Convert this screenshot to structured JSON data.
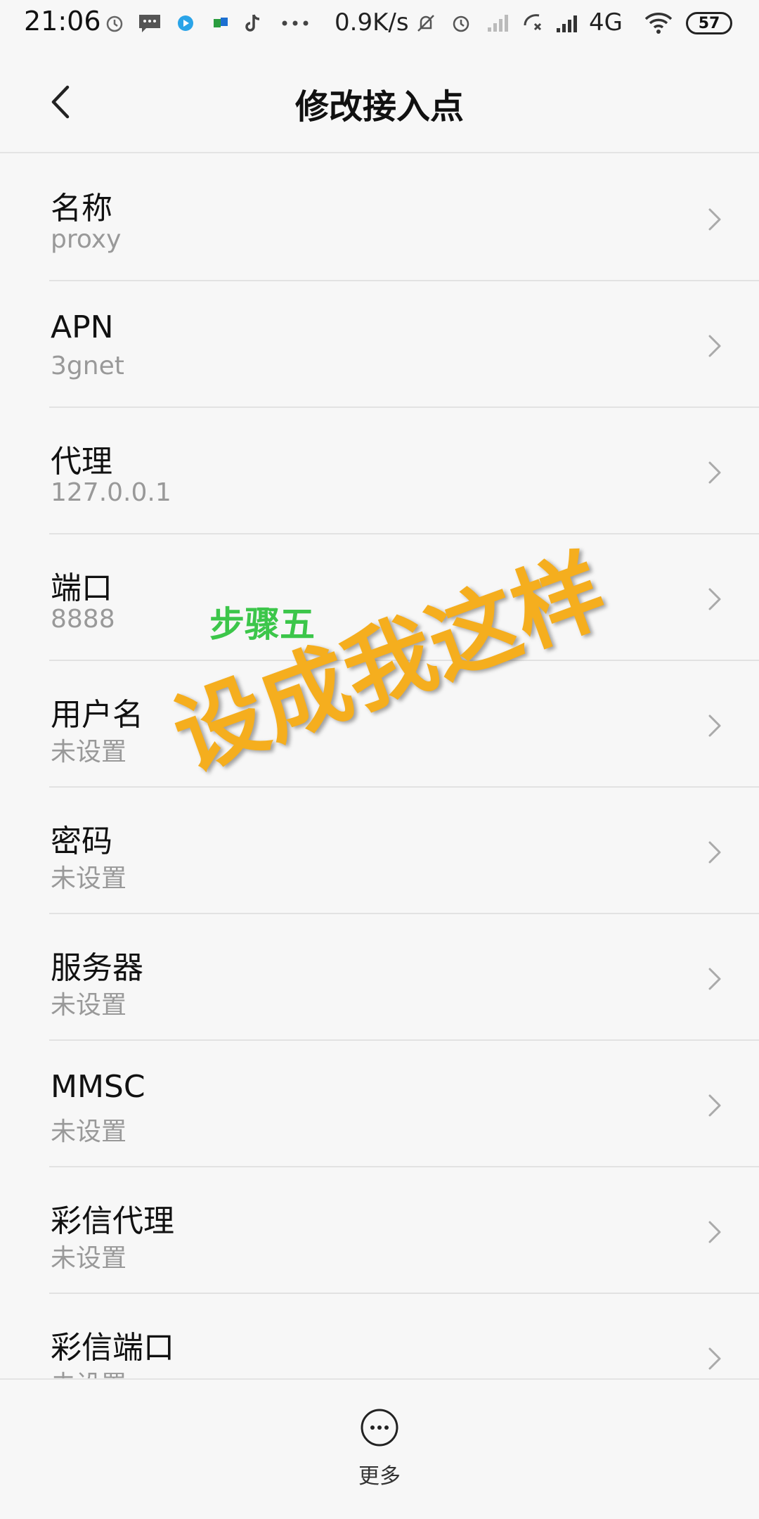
{
  "status_bar": {
    "time": "21:06",
    "speed": "0.9K/s",
    "network": "4G",
    "battery": "57",
    "icons": [
      "alarm-icon",
      "message-icon",
      "app-icon",
      "app-icon",
      "tiktok-icon",
      "more-dots-icon",
      "mute-icon",
      "alarm-icon",
      "no-signal-icon",
      "call-icon",
      "signal-icon",
      "wifi-icon"
    ]
  },
  "header": {
    "title": "修改接入点"
  },
  "list": {
    "items": [
      {
        "title": "名称",
        "value": "proxy"
      },
      {
        "title": "APN",
        "value": "3gnet"
      },
      {
        "title": "代理",
        "value": "127.0.0.1"
      },
      {
        "title": "端口",
        "value": "8888"
      },
      {
        "title": "用户名",
        "value": "未设置"
      },
      {
        "title": "密码",
        "value": "未设置"
      },
      {
        "title": "服务器",
        "value": "未设置"
      },
      {
        "title": "MMSC",
        "value": "未设置"
      },
      {
        "title": "彩信代理",
        "value": "未设置"
      },
      {
        "title": "彩信端口",
        "value": "未设置"
      }
    ]
  },
  "overlay": {
    "step": "步骤五",
    "instruction": "设成我这样"
  },
  "bottom": {
    "more_label": "更多"
  },
  "colors": {
    "step_green": "#3cc64a",
    "instruction_orange": "#f5ae1e"
  }
}
